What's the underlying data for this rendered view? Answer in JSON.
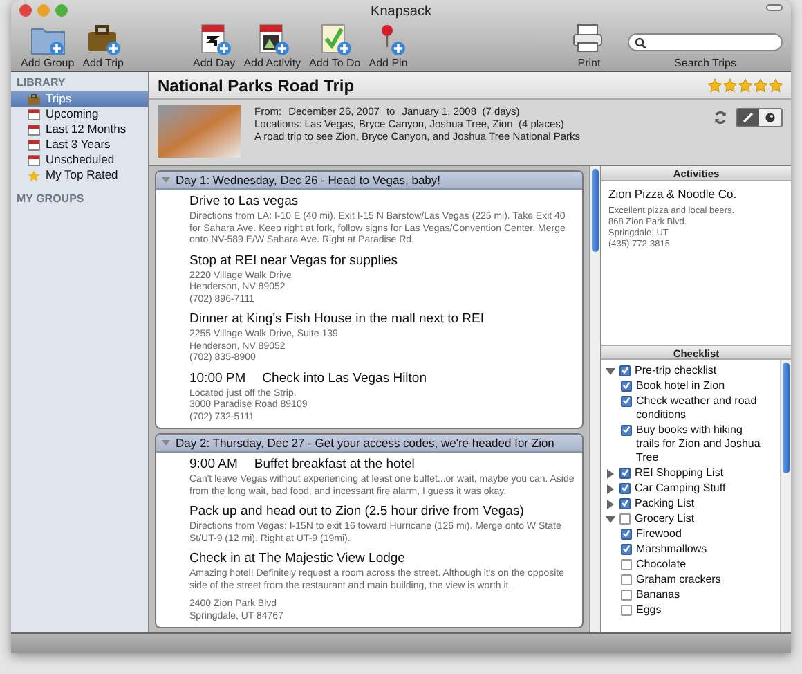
{
  "window": {
    "title": "Knapsack"
  },
  "toolbar": {
    "groups": [
      [
        {
          "label": "Add Group"
        },
        {
          "label": "Add Trip"
        }
      ],
      [
        {
          "label": "Add Day"
        },
        {
          "label": "Add Activity"
        },
        {
          "label": "Add To Do"
        },
        {
          "label": "Add Pin"
        }
      ],
      [
        {
          "label": "Print"
        }
      ]
    ],
    "search": {
      "label": "Search Trips"
    }
  },
  "sidebar": {
    "sections": [
      {
        "heading": "LIBRARY",
        "items": [
          {
            "label": "Trips",
            "selected": true
          },
          {
            "label": "Upcoming",
            "selected": false
          },
          {
            "label": "Last 12 Months",
            "selected": false
          },
          {
            "label": "Last 3 Years",
            "selected": false
          },
          {
            "label": "Unscheduled",
            "selected": false
          },
          {
            "label": "My Top Rated",
            "selected": false
          }
        ]
      },
      {
        "heading": "MY GROUPS"
      }
    ]
  },
  "trip": {
    "title": "National Parks Road Trip",
    "stars": 5,
    "from_label": "From:",
    "start": "December 26, 2007",
    "to_label": "to",
    "end": "January 1, 2008  (7 days)",
    "locations": "Locations: Las Vegas, Bryce Canyon, Joshua Tree, Zion  (4 places)",
    "description": "A road trip to see Zion, Bryce Canyon, and Joshua Tree National Parks",
    "view_modes": [
      {
        "selected": true
      },
      {
        "selected": false
      }
    ]
  },
  "days": [
    {
      "header": "Day 1:  Wednesday, Dec 26 - Head to Vegas, baby!",
      "expanded": true,
      "items": [
        {
          "title": "Drive to Las vegas",
          "notes": [
            "Directions from LA: I-10 E (40 mi). Exit I-15 N Barstow/Las Vegas (225 mi). Take Exit 40 for Sahara Ave. Keep right at fork, follow signs for Las Vegas/Convention Center. Merge onto NV-589 E/W Sahara Ave. Right at Paradise Rd."
          ]
        },
        {
          "title": "Stop at REI near Vegas for supplies",
          "notes": [
            "2220 Village Walk Drive\nHenderson, NV 89052\n(702) 896-7111"
          ]
        },
        {
          "title": "Dinner at King's Fish House in the mall next to REI",
          "notes": [
            "2255 Village Walk Drive, Suite 139\nHenderson, NV 89052\n(702) 835-8900"
          ]
        },
        {
          "time": "10:00 PM",
          "title": "Check into Las Vegas Hilton",
          "notes": [
            "Located just off the Strip.\n3000 Paradise Road 89109\n(702) 732-5111"
          ]
        }
      ]
    },
    {
      "header": "Day 2:  Thursday, Dec 27 - Get your access codes, we're headed for Zion",
      "expanded": true,
      "items": [
        {
          "time": "9:00 AM",
          "title": "Buffet breakfast at the hotel",
          "notes": [
            "Can't leave Vegas without experiencing at least one buffet...or wait, maybe you can. Aside from the long wait, bad food, and incessant fire alarm, I guess it was okay."
          ]
        },
        {
          "title": "Pack up and head out to Zion (2.5 hour drive from Vegas)",
          "notes": [
            "Directions from Vegas: I-15N to exit 16 toward Hurricane (126 mi). Merge onto W State St/UT-9 (12 mi). Right at UT-9 (19mi)."
          ]
        },
        {
          "title": "Check in at The Majestic View Lodge",
          "notes": [
            "Amazing hotel! Definitely request a room across the street. Although it's on the opposite side of the street from the restaurant and main building, the view is worth it.",
            "2400 Zion Park Blvd\nSpringdale, UT 84767"
          ]
        }
      ]
    }
  ],
  "activities": {
    "heading": "Activities",
    "title": "Zion Pizza & Noodle Co.",
    "notes": "Excellent pizza and local beers.\n868 Zion Park Blvd.\nSpringdale, UT\n(435) 772-3815"
  },
  "checklist": {
    "heading": "Checklist",
    "items": [
      {
        "label": "Pre-trip checklist",
        "checked": true,
        "expanded": true,
        "children": [
          {
            "label": "Book hotel in Zion",
            "checked": true
          },
          {
            "label": "Check weather and road conditions",
            "checked": true
          },
          {
            "label": "Buy books with hiking trails for Zion and Joshua Tree",
            "checked": true
          }
        ]
      },
      {
        "label": "REI Shopping List",
        "checked": true,
        "expanded": false
      },
      {
        "label": "Car Camping Stuff",
        "checked": true,
        "expanded": false
      },
      {
        "label": "Packing List",
        "checked": true,
        "expanded": false
      },
      {
        "label": "Grocery List",
        "checked": false,
        "expanded": true,
        "children": [
          {
            "label": "Firewood",
            "checked": true
          },
          {
            "label": "Marshmallows",
            "checked": true
          },
          {
            "label": "Chocolate",
            "checked": false
          },
          {
            "label": "Graham crackers",
            "checked": false
          },
          {
            "label": "Bananas",
            "checked": false
          },
          {
            "label": "Eggs",
            "checked": false
          }
        ]
      }
    ]
  }
}
